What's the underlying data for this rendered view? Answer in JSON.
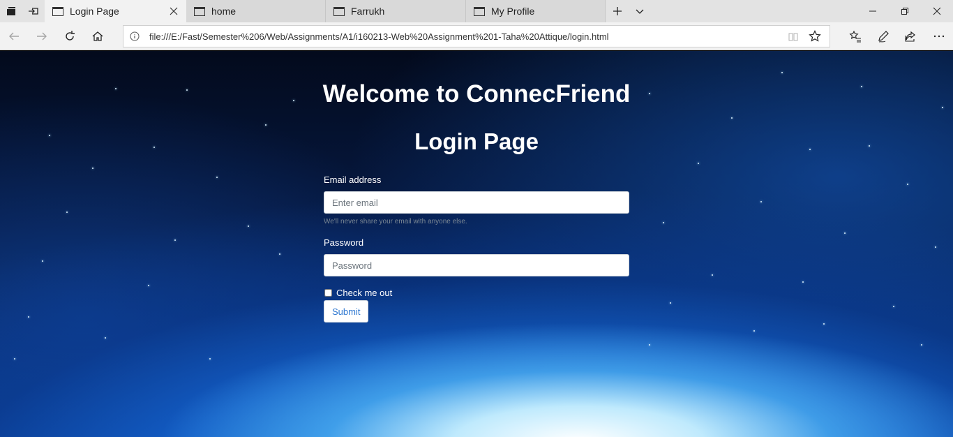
{
  "tabs": [
    {
      "label": "Login Page",
      "active": true
    },
    {
      "label": "home",
      "active": false
    },
    {
      "label": "Farrukh",
      "active": false
    },
    {
      "label": "My Profile",
      "active": false
    }
  ],
  "icons": {
    "tab_actions": "tab-actions-icon",
    "set_aside": "set-aside-tabs-icon",
    "new_tab": "plus-icon",
    "tab_preview": "chevron-down-icon",
    "back": "back-arrow-icon",
    "forward": "forward-arrow-icon",
    "refresh": "refresh-icon",
    "home": "home-icon",
    "info": "info-icon",
    "reading_view": "book-icon",
    "favorite": "star-icon",
    "favorites_hub": "favorites-list-icon",
    "notes": "pen-icon",
    "share": "share-icon",
    "more": "ellipsis-icon"
  },
  "address_bar": {
    "url": "file:///E:/Fast/Semester%206/Web/Assignments/A1/i160213-Web%20Assignment%201-Taha%20Attique/login.html"
  },
  "page": {
    "title": "Welcome to ConnecFriend",
    "subtitle": "Login Page",
    "form": {
      "email_label": "Email address",
      "email_placeholder": "Enter email",
      "email_help": "We'll never share your email with anyone else.",
      "password_label": "Password",
      "password_placeholder": "Password",
      "checkbox_label": "Check me out",
      "checkbox_checked": false,
      "submit_label": "Submit"
    }
  },
  "colors": {
    "tab_strip": "#e3e3e3",
    "active_tab": "#f2f2f2",
    "submit_text": "#2f78d1",
    "page_text": "#ffffff"
  }
}
